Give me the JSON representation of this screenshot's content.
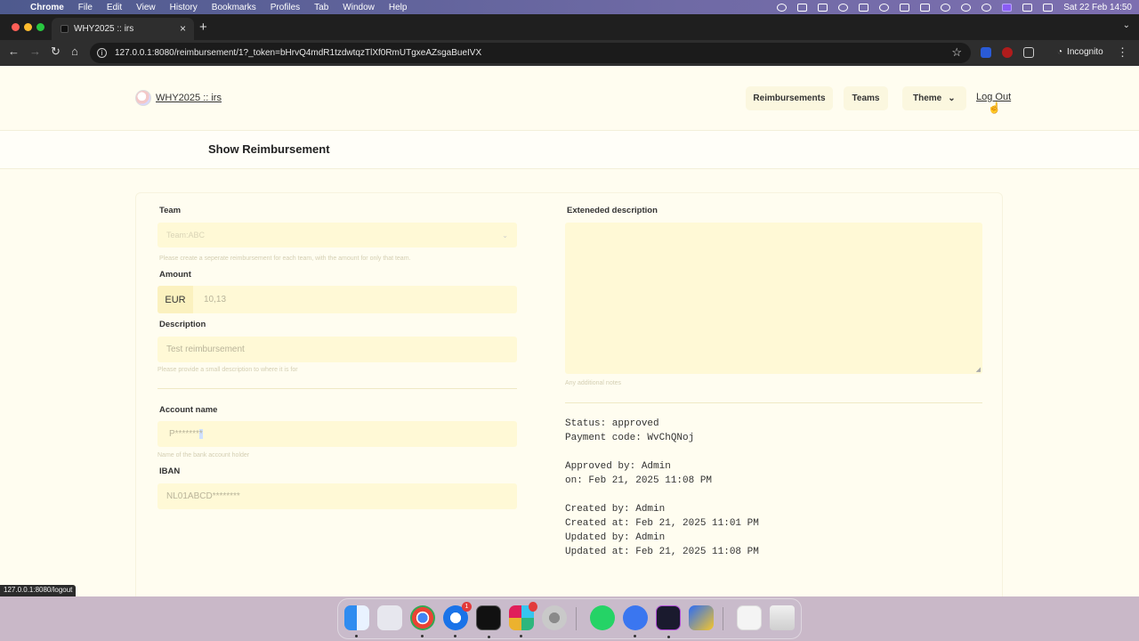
{
  "menubar": {
    "app_name": "Chrome",
    "items": [
      "File",
      "Edit",
      "View",
      "History",
      "Bookmarks",
      "Profiles",
      "Tab",
      "Window",
      "Help"
    ],
    "clock": "Sat 22 Feb  14:50"
  },
  "browser": {
    "tab_title": "WHY2025 :: irs",
    "url": "127.0.0.1:8080/reimbursement/1?_token=bHrvQ4mdR1tzdwtqzTlXf0RmUTgxeAZsgaBueIVX",
    "profile_label": "Incognito",
    "status_url": "127.0.0.1:8080/logout"
  },
  "nav": {
    "brand": "WHY2025 :: irs",
    "reimbursements": "Reimbursements",
    "teams": "Teams",
    "theme": "Theme",
    "logout": "Log Out"
  },
  "page_title": "Show Reimbursement",
  "form": {
    "team_label": "Team",
    "team_value": "Team:ABC",
    "team_hint": "Please create a seperate reimbursement for each team, with the amount for only that team.",
    "amount_label": "Amount",
    "currency": "EUR",
    "amount_value": "10,13",
    "description_label": "Description",
    "description_value": "Test reimbursement",
    "description_hint": "Please provide a small description to where it is for",
    "account_label": "Account name",
    "account_value": "P*******",
    "account_value_selected": "*",
    "account_hint": "Name of the bank account holder",
    "iban_label": "IBAN",
    "iban_value": "NL01ABCD********",
    "ext_label": "Exteneded description",
    "ext_value": "",
    "ext_hint": "Any additional notes"
  },
  "details": {
    "status": "Status: approved",
    "payment_code": "Payment code: WvChQNoj",
    "approved_by": "Approved by: Admin",
    "approved_on": "on: Feb 21, 2025 11:08 PM",
    "created_by": "Created by: Admin",
    "created_at": "Created at: Feb 21, 2025 11:01 PM",
    "updated_by": "Updated by: Admin",
    "updated_at": "Updated at: Feb 21, 2025 11:08 PM"
  },
  "dock": {
    "apps": [
      "finder",
      "launchpad",
      "chrome",
      "thunderbird",
      "terminal",
      "slack",
      "system-settings",
      "whatsapp",
      "signal",
      "phpstorm",
      "reeder",
      "preview",
      "trash"
    ],
    "slack_badge": "",
    "thunderbird_badge": "1"
  }
}
